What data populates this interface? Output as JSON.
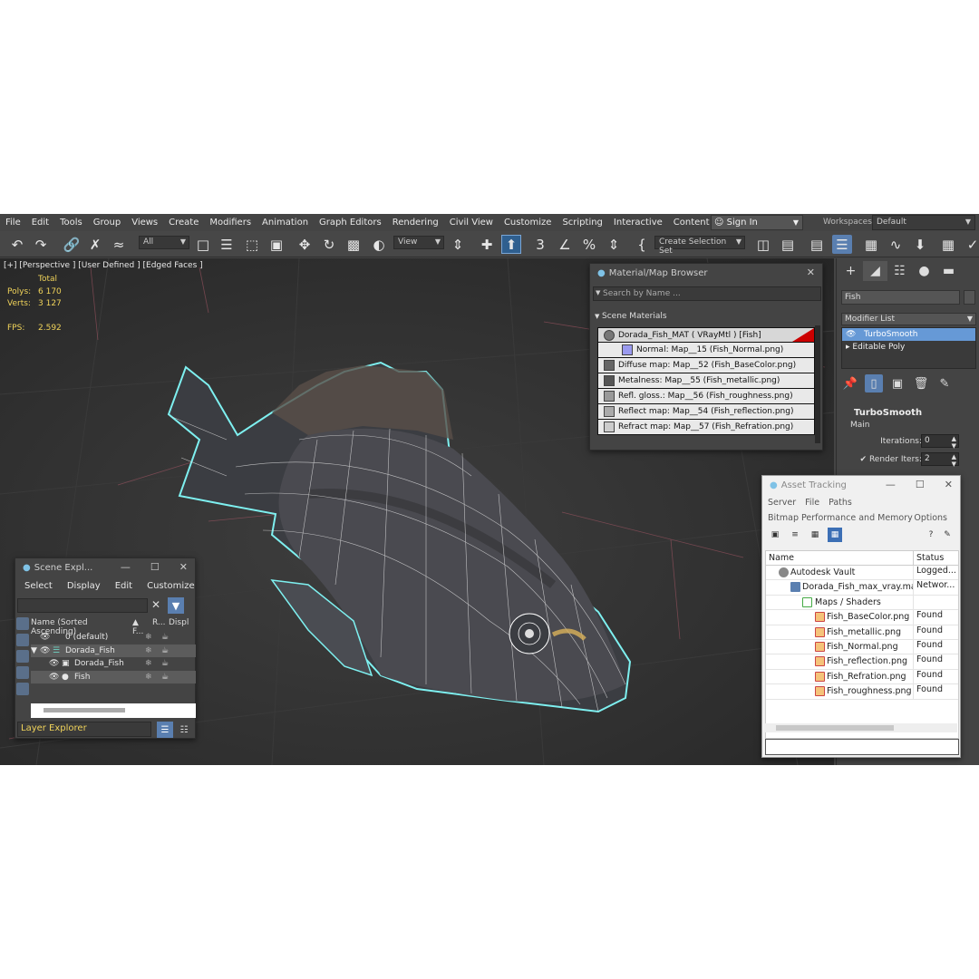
{
  "menu": [
    "File",
    "Edit",
    "Tools",
    "Group",
    "Views",
    "Create",
    "Modifiers",
    "Animation",
    "Graph Editors",
    "Rendering",
    "Civil View",
    "Customize",
    "Scripting",
    "Interactive",
    "Content"
  ],
  "signin": "Sign In",
  "workspaces": {
    "label": "Workspaces:",
    "value": "Default"
  },
  "toolbar": {
    "filter": "All",
    "view": "View",
    "selection_set": "Create Selection Set"
  },
  "viewport": {
    "label": "[+] [Perspective ] [User Defined ] [Edged Faces ]",
    "stats": {
      "header": "Total",
      "polys_label": "Polys:",
      "polys": "6 170",
      "verts_label": "Verts:",
      "verts": "3 127",
      "fps_label": "FPS:",
      "fps": "2.592"
    }
  },
  "command_panel": {
    "object_name": "Fish",
    "modifier_list": "Modifier List",
    "stack": [
      "TurboSmooth",
      "Editable Poly"
    ],
    "rollout_title": "TurboSmooth",
    "main": "Main",
    "iterations_label": "Iterations:",
    "iterations": "0",
    "render_iters_label": "Render Iters:",
    "render_iters": "2"
  },
  "material_browser": {
    "title": "Material/Map Browser",
    "search_placeholder": "Search by Name ...",
    "section": "Scene Materials",
    "rows": [
      "Dorada_Fish_MAT  ( VRayMtl )  [Fish]",
      "Normal: Map__15 (Fish_Normal.png)",
      "Diffuse map: Map__52 (Fish_BaseColor.png)",
      "Metalness: Map__55 (Fish_metallic.png)",
      "Refl. gloss.: Map__56 (Fish_roughness.png)",
      "Reflect map: Map__54 (Fish_reflection.png)",
      "Refract map: Map__57 (Fish_Refration.png)"
    ]
  },
  "scene_explorer": {
    "title": "Scene Expl...",
    "menu": [
      "Select",
      "Display",
      "Edit",
      "Customize"
    ],
    "columns": [
      "Name (Sorted Ascending)",
      "▲ F...",
      "R...",
      "Displ"
    ],
    "rows": [
      "0 (default)",
      "Dorada_Fish",
      "Dorada_Fish",
      "Fish"
    ],
    "bottom": "Layer Explorer"
  },
  "asset_tracking": {
    "title": "Asset Tracking",
    "menu1": [
      "Server",
      "File",
      "Paths"
    ],
    "menu2": "Bitmap Performance and Memory",
    "options": "Options",
    "col_name": "Name",
    "col_status": "Status",
    "rows": [
      {
        "name": "Autodesk Vault",
        "status": "Logged..."
      },
      {
        "name": "Dorada_Fish_max_vray.max",
        "status": "Networ..."
      },
      {
        "name": "Maps / Shaders",
        "status": ""
      },
      {
        "name": "Fish_BaseColor.png",
        "status": "Found"
      },
      {
        "name": "Fish_metallic.png",
        "status": "Found"
      },
      {
        "name": "Fish_Normal.png",
        "status": "Found"
      },
      {
        "name": "Fish_reflection.png",
        "status": "Found"
      },
      {
        "name": "Fish_Refration.png",
        "status": "Found"
      },
      {
        "name": "Fish_roughness.png",
        "status": "Found"
      }
    ]
  }
}
